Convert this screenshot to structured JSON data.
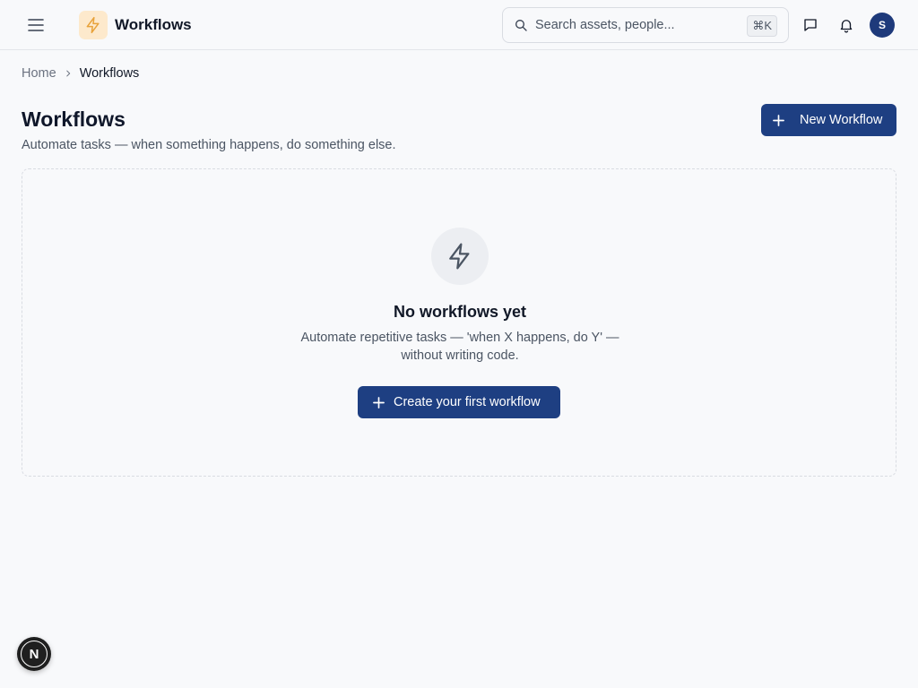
{
  "header": {
    "app_title": "Workflows",
    "menu_icon": "hamburger-menu-icon",
    "logo_icon": "lightning-bolt-icon",
    "search": {
      "placeholder": "Search assets, people...",
      "value": "",
      "shortcut": "⌘K"
    },
    "actions": [
      {
        "icon": "message-icon"
      },
      {
        "icon": "bell-icon"
      }
    ],
    "avatar_initial": "S"
  },
  "breadcrumb": {
    "items": [
      "Home",
      "Workflows"
    ]
  },
  "page": {
    "title": "Workflows",
    "subtitle": "Automate tasks — when something happens, do something else.",
    "new_button_label": "New Workflow"
  },
  "empty_state": {
    "icon": "lightning-bolt-icon",
    "title": "No workflows yet",
    "description": "Automate repetitive tasks — 'when X happens, do Y' — without writing code.",
    "cta_label": "Create your first workflow"
  },
  "dev_badge": {
    "letter": "N"
  },
  "colors": {
    "primary": "#1e3f82",
    "background": "#f8f9fb",
    "logo_bg": "#fde9cc",
    "logo_icon": "#e8a23a",
    "avatar": "#1e3a7b"
  }
}
